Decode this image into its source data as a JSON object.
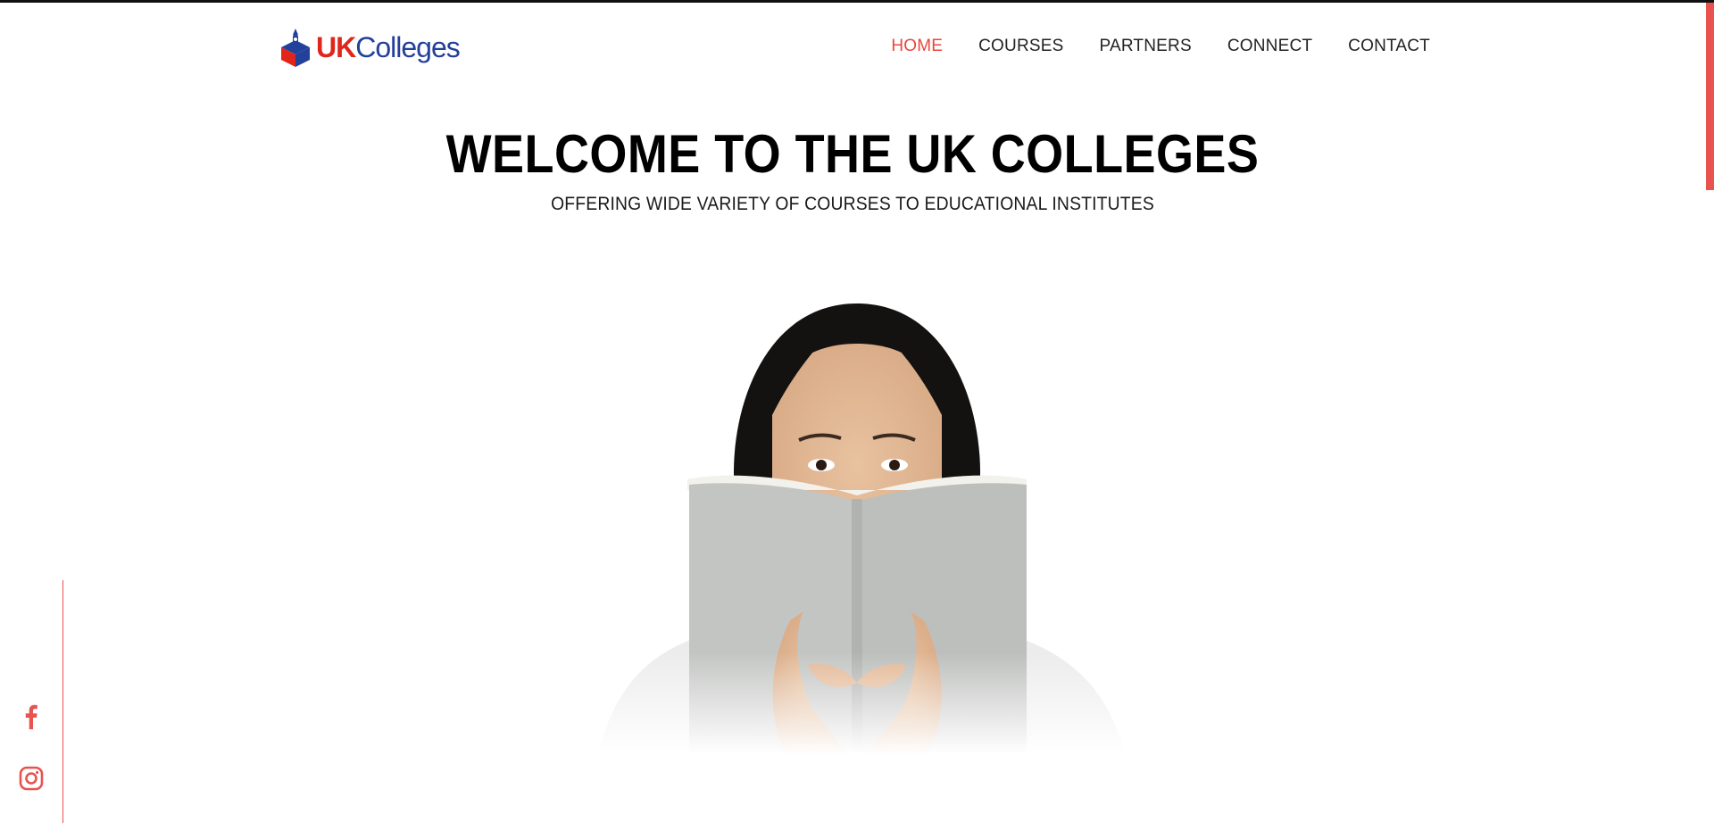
{
  "brand": {
    "uk": "UK",
    "colleges": "Colleges"
  },
  "nav": {
    "items": [
      {
        "label": "HOME",
        "active": true
      },
      {
        "label": "COURSES",
        "active": false
      },
      {
        "label": "PARTNERS",
        "active": false
      },
      {
        "label": "CONNECT",
        "active": false
      },
      {
        "label": "CONTACT",
        "active": false
      }
    ]
  },
  "hero": {
    "title": "WELCOME TO THE UK COLLEGES",
    "subtitle": "OFFERING WIDE VARIETY OF COURSES TO EDUCATIONAL INSTITUTES",
    "image": "woman-reading-book"
  },
  "social": {
    "icons": [
      "facebook-icon",
      "instagram-icon"
    ]
  },
  "colors": {
    "accent": "#e85350",
    "brand_red": "#e1251b",
    "brand_blue": "#23409a"
  }
}
